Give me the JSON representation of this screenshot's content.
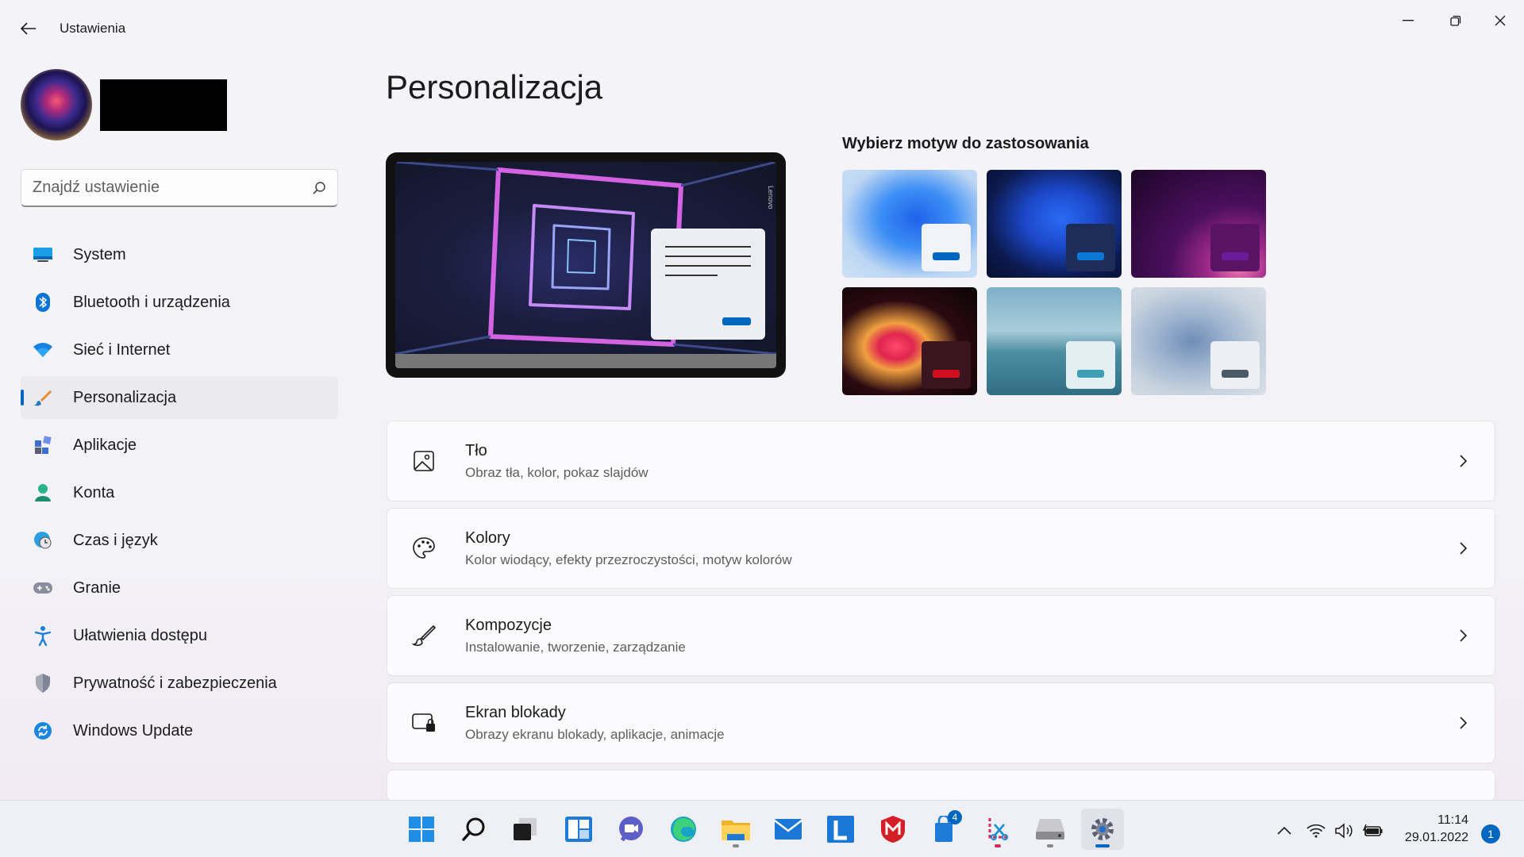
{
  "app": {
    "title": "Ustawienia"
  },
  "search": {
    "placeholder": "Znajdź ustawienie"
  },
  "sidebar": {
    "items": [
      {
        "label": "System",
        "icon": "system-icon"
      },
      {
        "label": "Bluetooth i urządzenia",
        "icon": "bluetooth-icon"
      },
      {
        "label": "Sieć i Internet",
        "icon": "wifi-icon"
      },
      {
        "label": "Personalizacja",
        "icon": "brush-icon",
        "active": true
      },
      {
        "label": "Aplikacje",
        "icon": "apps-icon"
      },
      {
        "label": "Konta",
        "icon": "person-icon"
      },
      {
        "label": "Czas i język",
        "icon": "globe-clock-icon"
      },
      {
        "label": "Granie",
        "icon": "gamepad-icon"
      },
      {
        "label": "Ułatwienia dostępu",
        "icon": "accessibility-icon"
      },
      {
        "label": "Prywatność i zabezpieczenia",
        "icon": "shield-icon"
      },
      {
        "label": "Windows Update",
        "icon": "update-icon"
      }
    ]
  },
  "main": {
    "title": "Personalizacja",
    "themes_title": "Wybierz motyw do zastosowania",
    "preview_brand": "Lenovo",
    "cards": [
      {
        "title": "Tło",
        "subtitle": "Obraz tła, kolor, pokaz slajdów",
        "icon": "image-icon"
      },
      {
        "title": "Kolory",
        "subtitle": "Kolor wiodący, efekty przezroczystości, motyw kolorów",
        "icon": "palette-icon"
      },
      {
        "title": "Kompozycje",
        "subtitle": "Instalowanie, tworzenie, zarządzanie",
        "icon": "brush-icon"
      },
      {
        "title": "Ekran blokady",
        "subtitle": "Obrazy ekranu blokady, aplikacje, animacje",
        "icon": "lock-screen-icon"
      }
    ]
  },
  "taskbar": {
    "badge_store": "4",
    "time": "11:14",
    "date": "29.01.2022",
    "notifications": "1"
  },
  "colors": {
    "accent": "#0067c0",
    "window_bg": "#f3f3f6",
    "card_bg": "#fbfbfd"
  }
}
